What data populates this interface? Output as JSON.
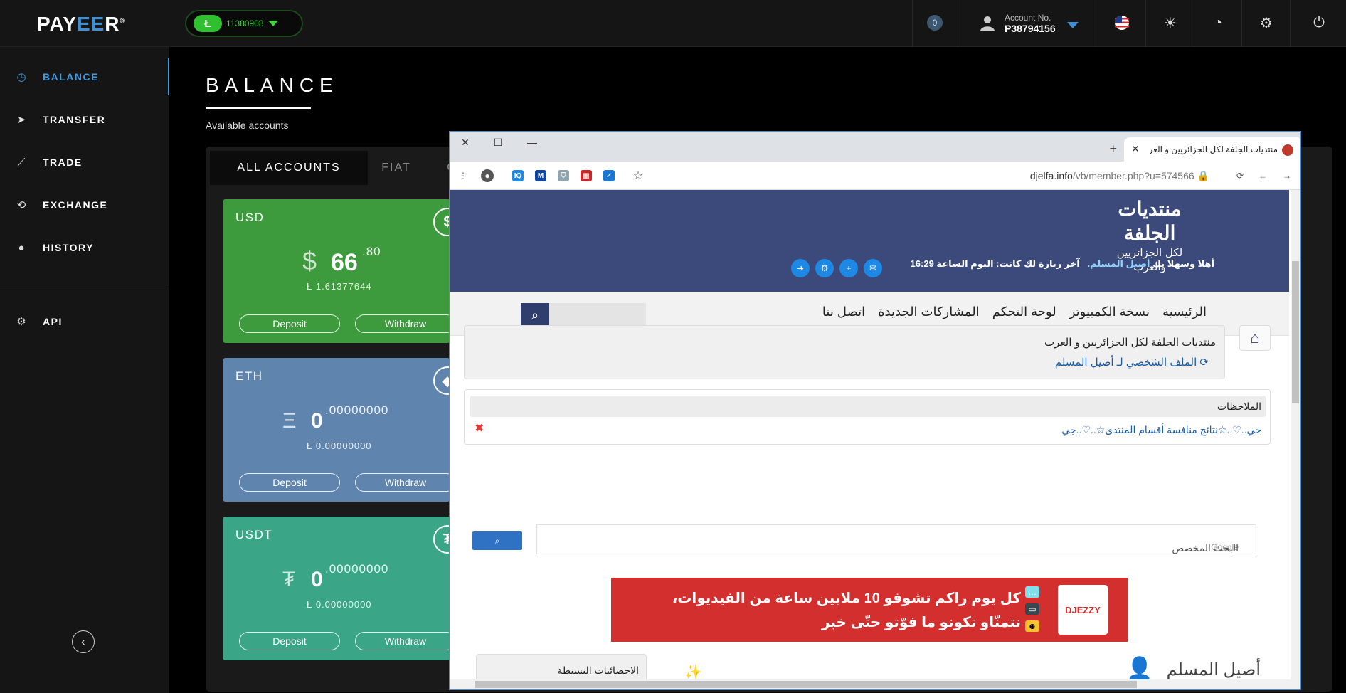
{
  "app": {
    "logo_pay": "PAY",
    "logo_ee": "EE",
    "logo_r": "R",
    "logo_mark": "®"
  },
  "topbar": {
    "ltc_badge": "Ł",
    "ltc_value": "11380908",
    "notifications": "0",
    "account_label": "Account No.",
    "account_no": "P38794156"
  },
  "sidebar": {
    "items": [
      {
        "label": "BALANCE",
        "icon": "gauge-icon"
      },
      {
        "label": "TRANSFER",
        "icon": "paper-plane-icon"
      },
      {
        "label": "TRADE",
        "icon": "chart-icon"
      },
      {
        "label": "EXCHANGE",
        "icon": "exchange-icon"
      },
      {
        "label": "HISTORY",
        "icon": "clock-icon"
      },
      {
        "label": "API",
        "icon": "gears-icon"
      }
    ]
  },
  "main": {
    "title": "BALANCE",
    "subtitle": "Available accounts",
    "tabs": [
      "ALL ACCOUNTS",
      "FIAT",
      "C"
    ]
  },
  "cards": [
    {
      "name": "USD",
      "symbol": "$",
      "amount": "66",
      "fraction": ".80",
      "sub": "Ł  1.61377644",
      "color": "#3d9a3d",
      "deposit": "Deposit",
      "withdraw": "Withdraw",
      "badge": "$"
    },
    {
      "name": "ETH",
      "symbol": "Ξ",
      "amount": "0",
      "fraction": ".00000000",
      "sub": "Ł  0.00000000",
      "color": "#5f85ae",
      "deposit": "Deposit",
      "withdraw": "Withdraw",
      "badge": "◆"
    },
    {
      "name": "USDT",
      "symbol": "₮",
      "amount": "0",
      "fraction": ".00000000",
      "sub": "Ł  0.00000000",
      "color": "#3aa687",
      "deposit": "Deposit",
      "withdraw": "Withdraw",
      "badge": "₮"
    }
  ],
  "browser": {
    "tab_title": "منتديات الجلفة لكل الجزائريين و العرب",
    "url_host": "djelfa.info",
    "url_path": "/vb/member.php?u=574566",
    "extensions": [
      {
        "label": "IQ",
        "color": "#1e88e5"
      },
      {
        "label": "M",
        "color": "#0d47a1"
      },
      {
        "label": "⛉",
        "color": "#90a4ae"
      },
      {
        "label": "▦",
        "color": "#c62828"
      },
      {
        "label": "✓",
        "color": "#1976d2"
      }
    ]
  },
  "site": {
    "logo_line1": "منتديات الجلفة",
    "logo_line2": "لكل الجزائريين والعرب",
    "welcome_prefix": "أهلا وسهلا بك",
    "welcome_user": "أصيل المسلم.",
    "last_visit": "آخر زيارة لك كانت: اليوم الساعة 16:29",
    "nav": [
      "الرئيسية",
      "نسخة الكمبيوتر",
      "لوحة التحكم",
      "المشاركات الجديدة",
      "اتصل بنا"
    ],
    "breadcrumb_title": "منتديات الجلفة لكل الجزائريين و العرب",
    "breadcrumb_link": "الملف الشخصي لـ أصيل المسلم",
    "notes_title": "الملاحظات",
    "notes_link": "جي..♡..☆نتائج منافسة أقسام المنتدى☆..♡..جي",
    "gsearch_brand": "Google",
    "gsearch_placeholder": "البحث المخصص",
    "ad_brand": "DJEZZY",
    "ad_line1": "كل يوم راكم تشوفو 10 ملايين ساعة من الفيديوات،",
    "ad_line2": "نتمنّاو تكونو ما فوّتو حتّى خبر",
    "profile_name": "أصيل المسلم",
    "stats_tab": "الاحصائيات البسيطة"
  }
}
